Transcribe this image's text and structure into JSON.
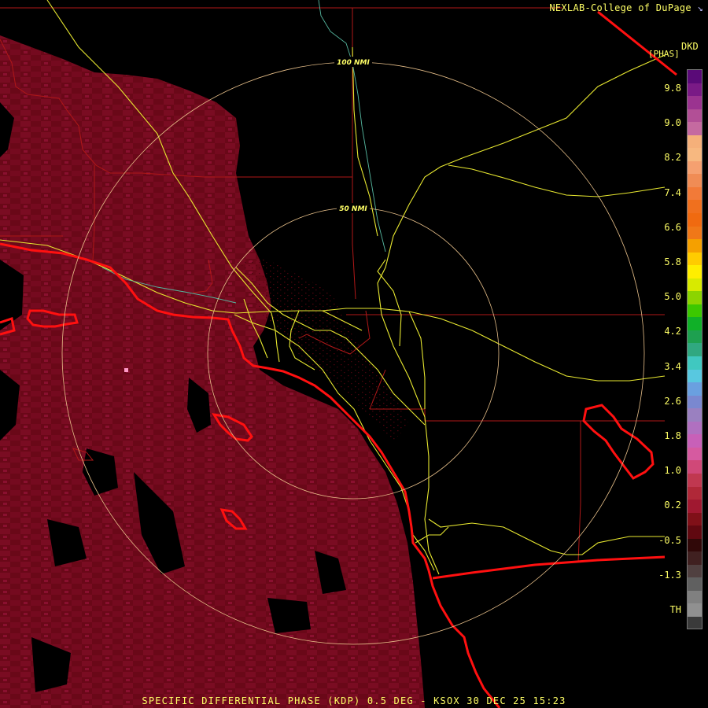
{
  "header": {
    "credit": "NEXLAB-College of DuPage",
    "credit_icon": "arrow-corner-icon",
    "product": "DKD",
    "unit": "[PHAS]"
  },
  "map": {
    "ring_labels": [
      "100 NMI",
      "50 NMI"
    ]
  },
  "legend": {
    "ticks": [
      "9.8",
      "9.0",
      "8.2",
      "7.4",
      "6.6",
      "5.8",
      "5.0",
      "4.2",
      "3.4",
      "2.6",
      "1.8",
      "1.0",
      "0.2",
      "-0.5",
      "-1.3",
      "TH"
    ],
    "colors": [
      "#5a0a78",
      "#7a1a86",
      "#9b3390",
      "#b24f96",
      "#c56aa0",
      "#f5b07a",
      "#f7b880",
      "#f5a070",
      "#f08c55",
      "#f27a38",
      "#f0701e",
      "#f06a10",
      "#f07818",
      "#f5a000",
      "#ffcc00",
      "#ffee00",
      "#d8ea00",
      "#8cd400",
      "#3cc800",
      "#10b028",
      "#1ea050",
      "#30a880",
      "#40c8c0",
      "#58c8e0",
      "#6aa0e0",
      "#7a88d0",
      "#9a80c0",
      "#b070c0",
      "#c860b8",
      "#d65aa0",
      "#d04878",
      "#c03850",
      "#b02838",
      "#a01830",
      "#801018",
      "#600810",
      "#300808",
      "#402020",
      "#504040",
      "#606060",
      "#808080",
      "#909090",
      "#3a3a3a"
    ]
  },
  "footer": {
    "caption": "SPECIFIC DIFFERENTIAL PHASE (KDP) 0.5 DEG - KSOX 30 DEC 25 15:23"
  }
}
